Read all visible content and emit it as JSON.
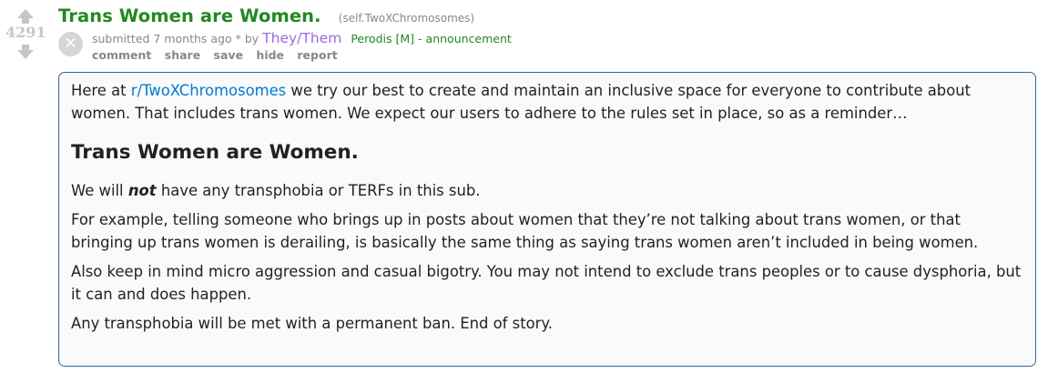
{
  "vote": {
    "score": "4291"
  },
  "post": {
    "title": "Trans Women are Women.",
    "domain": "(self.TwoXChromosomes)",
    "close_glyph": "✕",
    "tagline": {
      "submitted": "submitted 7 months ago * by",
      "author": "They/Them",
      "flair": "Perodis",
      "mod": "[M]",
      "dash": "-",
      "announce": "announcement"
    },
    "buttons": [
      "comment",
      "share",
      "save",
      "hide",
      "report"
    ]
  },
  "body": {
    "intro_pre": "Here at",
    "intro_link": "r/TwoXChromosomes",
    "intro_post": "we try our best to create and maintain an inclusive space for everyone to contribute about women. That includes trans women. We expect our users to adhere to the rules set in place, so as a reminder…",
    "heading": "Trans Women are Women.",
    "p1_pre": "We will",
    "p1_em": "not",
    "p1_post": "have any transphobia or TERFs in this sub.",
    "p2": "For example, telling someone who brings up in posts about women that they’re not talking about trans women, or that bringing up trans women is derailing, is basically the same thing as saying trans women aren’t included in being women.",
    "p3": "Also keep in mind micro aggression and casual bigotry. You may not intend to exclude trans peoples or to cause dysphoria, but it can and does happen.",
    "p4": "Any transphobia will be met with a permanent ban. End of story."
  }
}
